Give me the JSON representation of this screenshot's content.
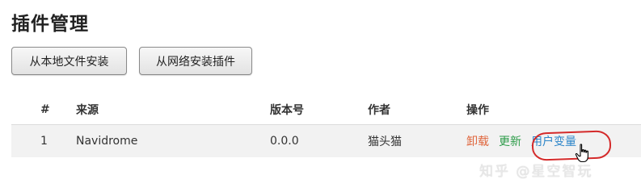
{
  "page_title": "插件管理",
  "toolbar": {
    "install_local_label": "从本地文件安装",
    "install_network_label": "从网络安装插件"
  },
  "table": {
    "headers": {
      "index": "#",
      "source": "来源",
      "version": "版本号",
      "author": "作者",
      "actions": "操作"
    },
    "rows": [
      {
        "index": "1",
        "source": "Navidrome",
        "version": "0.0.0",
        "author": "猫头猫",
        "actions": {
          "uninstall": "卸载",
          "update": "更新",
          "user_vars": "用户变量"
        }
      }
    ]
  },
  "colors": {
    "uninstall": "#e0673e",
    "update": "#2e9c4a",
    "user_vars": "#2e86c9",
    "highlight_ring": "#d42a2a"
  },
  "watermark": "知乎 @星空智玩"
}
